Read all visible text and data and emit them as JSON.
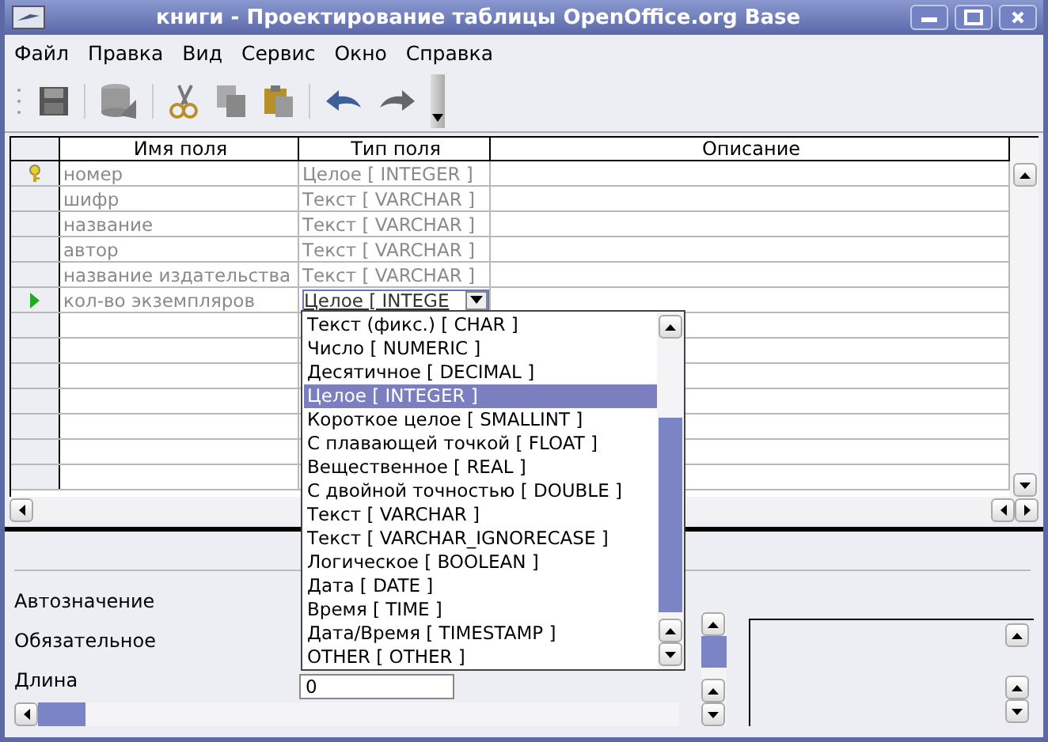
{
  "window": {
    "title": "книги - Проектирование таблицы OpenOffice.org Base"
  },
  "menu": [
    "Файл",
    "Правка",
    "Вид",
    "Сервис",
    "Окно",
    "Справка"
  ],
  "table": {
    "columns": [
      "Имя поля",
      "Тип поля",
      "Описание"
    ],
    "rows": [
      {
        "primary_key": true,
        "current": false,
        "name": "номер",
        "type": "Целое [ INTEGER ]"
      },
      {
        "primary_key": false,
        "current": false,
        "name": "шифр",
        "type": "Текст [ VARCHAR ]"
      },
      {
        "primary_key": false,
        "current": false,
        "name": "название",
        "type": "Текст [ VARCHAR ]"
      },
      {
        "primary_key": false,
        "current": false,
        "name": "автор",
        "type": "Текст [ VARCHAR ]"
      },
      {
        "primary_key": false,
        "current": false,
        "name": "название издательства",
        "type": "Текст [ VARCHAR ]"
      },
      {
        "primary_key": false,
        "current": true,
        "name": "кол-во экземпляров",
        "type": "Целое [ INTEGE"
      }
    ]
  },
  "type_dropdown": {
    "options": [
      {
        "label": "Текст (фикс.) [ CHAR ]",
        "selected": false
      },
      {
        "label": "Число [ NUMERIC ]",
        "selected": false
      },
      {
        "label": "Десятичное [ DECIMAL ]",
        "selected": false
      },
      {
        "label": "Целое [ INTEGER ]",
        "selected": true
      },
      {
        "label": "Короткое целое [ SMALLINT ]",
        "selected": false
      },
      {
        "label": "С плавающей точкой [ FLOAT ]",
        "selected": false
      },
      {
        "label": "Вещественное [ REAL ]",
        "selected": false
      },
      {
        "label": "С двойной точностью [ DOUBLE ]",
        "selected": false
      },
      {
        "label": "Текст [ VARCHAR ]",
        "selected": false
      },
      {
        "label": "Текст [ VARCHAR_IGNORECASE ]",
        "selected": false
      },
      {
        "label": "Логическое [ BOOLEAN ]",
        "selected": false
      },
      {
        "label": "Дата [ DATE ]",
        "selected": false
      },
      {
        "label": "Время [ TIME ]",
        "selected": false
      },
      {
        "label": "Дата/Время [ TIMESTAMP ]",
        "selected": false
      },
      {
        "label": "OTHER [ OTHER ]",
        "selected": false
      }
    ]
  },
  "properties": [
    {
      "label": "Автозначение"
    },
    {
      "label": "Обязательное"
    },
    {
      "label": "Длина",
      "value": "0"
    }
  ]
}
